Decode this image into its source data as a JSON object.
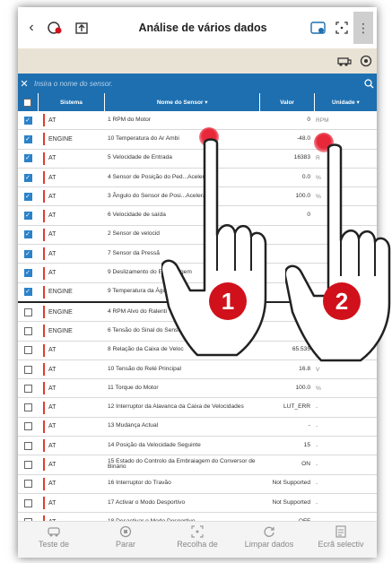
{
  "header": {
    "title": "Análise de vários dados",
    "menu_glyph": "⋮"
  },
  "search": {
    "placeholder": "Insira o nome do sensor."
  },
  "table": {
    "headers": {
      "sistema": "Sistema",
      "nome": "Nome do Sensor",
      "valor": "Valor",
      "unidade": "Unidade"
    },
    "rows": [
      {
        "checked": true,
        "sistema": "AT",
        "nome": "1 RPM do Motor",
        "valor": "0",
        "unidade": "RPM"
      },
      {
        "checked": true,
        "sistema": "ENGINE",
        "nome": "10 Temperatura do Ar Ambi",
        "valor": "-48.0",
        "unidade": "°C"
      },
      {
        "checked": true,
        "sistema": "AT",
        "nome": "5 Velocidade de Entrada",
        "valor": "16383",
        "unidade": "R"
      },
      {
        "checked": true,
        "sistema": "AT",
        "nome": "4 Sensor de Posição do Ped...Acelerador",
        "valor": "0.0",
        "unidade": "%"
      },
      {
        "checked": true,
        "sistema": "AT",
        "nome": "3 Ângulo do Sensor de Posi...Acelerador",
        "valor": "100.0",
        "unidade": "%"
      },
      {
        "checked": true,
        "sistema": "AT",
        "nome": "6 Velocidade de saída",
        "valor": "0",
        "unidade": ""
      },
      {
        "checked": true,
        "sistema": "AT",
        "nome": "2 Sensor de velocid",
        "valor": "",
        "unidade": ""
      },
      {
        "checked": true,
        "sistema": "AT",
        "nome": "7 Sensor da Pressã",
        "valor": "",
        "unidade": ""
      },
      {
        "checked": true,
        "sistema": "AT",
        "nome": "9 Deslizamento do Embraiagem",
        "valor": "",
        "unidade": ""
      },
      {
        "checked": true,
        "sistema": "ENGINE",
        "nome": "9 Temperatura da Água",
        "valor": "",
        "unidade": ""
      },
      {
        "checked": false,
        "sistema": "ENGINE",
        "nome": "4 RPM Alvo do Ralenti",
        "valor": "",
        "unidade": ""
      },
      {
        "checked": false,
        "sistema": "ENGINE",
        "nome": "6 Tensão do Sinal do Sensor",
        "valor": "0.0",
        "unidade": "V"
      },
      {
        "checked": false,
        "sistema": "AT",
        "nome": "8 Relação da Caixa de Veloc",
        "valor": "65.535",
        "unidade": "-"
      },
      {
        "checked": false,
        "sistema": "AT",
        "nome": "10 Tensão do Relé Principal",
        "valor": "16.8",
        "unidade": "V"
      },
      {
        "checked": false,
        "sistema": "AT",
        "nome": "11 Torque do Motor",
        "valor": "100.0",
        "unidade": "%"
      },
      {
        "checked": false,
        "sistema": "AT",
        "nome": "12 Interruptor da Alavanca da Caixa de Velocidades",
        "valor": "LUT_ERR",
        "unidade": "-"
      },
      {
        "checked": false,
        "sistema": "AT",
        "nome": "13 Mudança Actual",
        "valor": "-",
        "unidade": "-"
      },
      {
        "checked": false,
        "sistema": "AT",
        "nome": "14 Posição da Velocidade Seguinte",
        "valor": "15",
        "unidade": "-"
      },
      {
        "checked": false,
        "sistema": "AT",
        "nome": "15 Estado do Controlo da Embraiagem do Conversor de Binário",
        "valor": "ON",
        "unidade": "-"
      },
      {
        "checked": false,
        "sistema": "AT",
        "nome": "16 Interruptor do Travão",
        "valor": "Not Supported",
        "unidade": "-"
      },
      {
        "checked": false,
        "sistema": "AT",
        "nome": "17 Activar o Modo Desportivo",
        "valor": "Not Supported",
        "unidade": "-"
      },
      {
        "checked": false,
        "sistema": "AT",
        "nome": "18 Desactivar o Modo Desportivo",
        "valor": "OFF",
        "unidade": "-"
      }
    ]
  },
  "bottom_nav": [
    {
      "label": "Teste de",
      "icon": "car-test-icon"
    },
    {
      "label": "Parar",
      "icon": "stop-icon"
    },
    {
      "label": "Recolha de",
      "icon": "capture-icon"
    },
    {
      "label": "Limpar dados",
      "icon": "refresh-icon"
    },
    {
      "label": "Ecrã selectiv",
      "icon": "report-icon"
    }
  ],
  "overlay": {
    "badge_1": "1",
    "badge_2": "2"
  },
  "colors": {
    "accent_blue": "#1d6fb0",
    "system_marker_red": "#e23b2e",
    "badge_red": "#d0111b"
  }
}
